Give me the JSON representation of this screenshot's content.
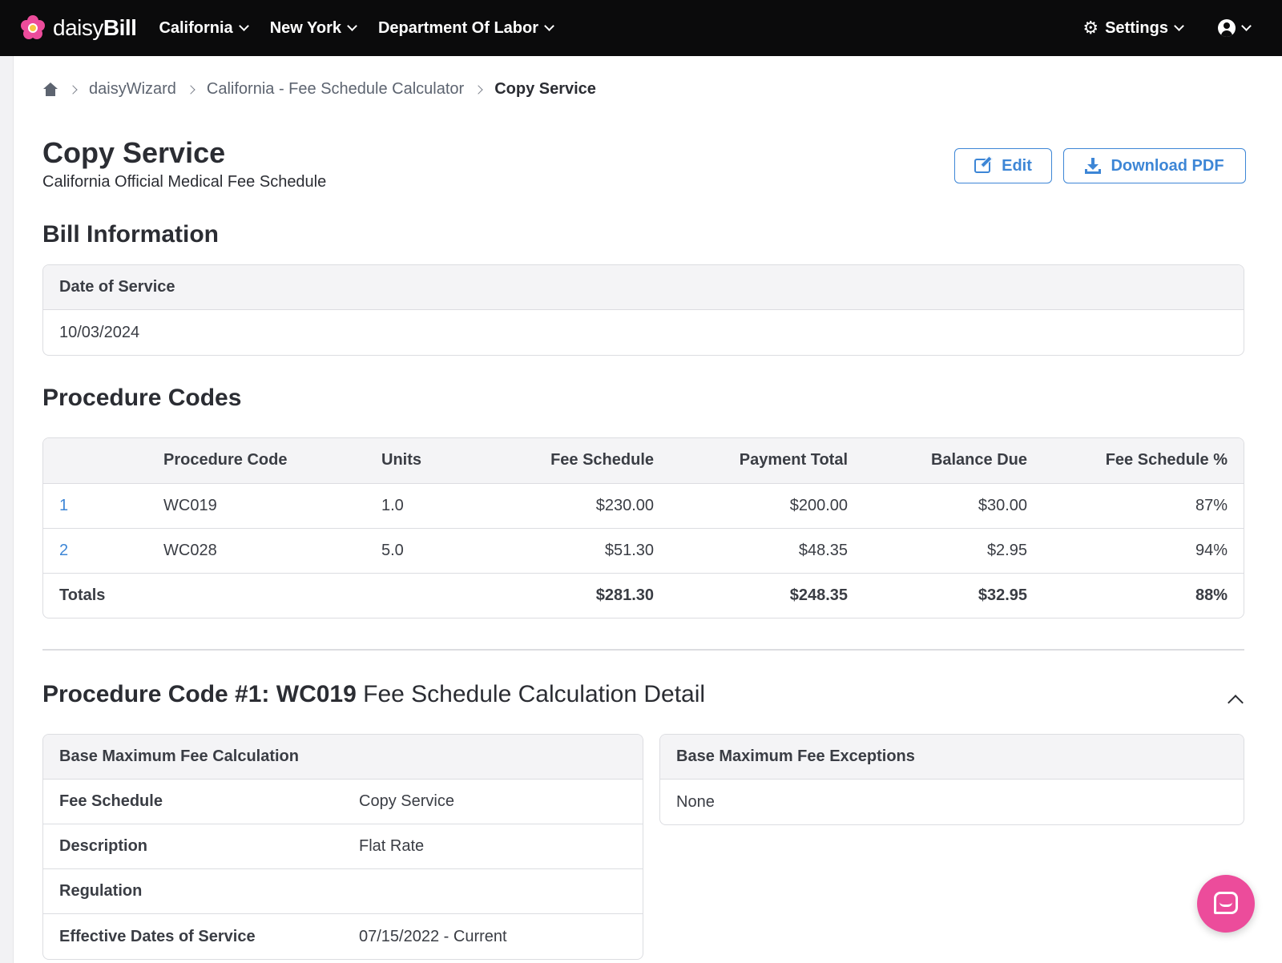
{
  "nav": {
    "logo_light": "daisy",
    "logo_bold": "Bill",
    "items": [
      {
        "label": "California"
      },
      {
        "label": "New York"
      },
      {
        "label": "Department Of Labor"
      }
    ],
    "settings_label": "Settings"
  },
  "breadcrumb": {
    "items": [
      "daisyWizard",
      "California - Fee Schedule Calculator"
    ],
    "current": "Copy Service"
  },
  "page": {
    "title": "Copy Service",
    "subtitle": "California Official Medical Fee Schedule",
    "edit_label": "Edit",
    "download_label": "Download PDF"
  },
  "bill_info": {
    "title": "Bill Information",
    "date_label": "Date of Service",
    "date_value": "10/03/2024"
  },
  "procedures": {
    "title": "Procedure Codes",
    "headers": [
      "",
      "Procedure Code",
      "Units",
      "Fee Schedule",
      "Payment Total",
      "Balance Due",
      "Fee Schedule %"
    ],
    "rows": [
      {
        "num": "1",
        "code": "WC019",
        "units": "1.0",
        "fee": "$230.00",
        "payment": "$200.00",
        "balance": "$30.00",
        "pct": "87%"
      },
      {
        "num": "2",
        "code": "WC028",
        "units": "5.0",
        "fee": "$51.30",
        "payment": "$48.35",
        "balance": "$2.95",
        "pct": "94%"
      }
    ],
    "totals": {
      "label": "Totals",
      "fee": "$281.30",
      "payment": "$248.35",
      "balance": "$32.95",
      "pct": "88%"
    }
  },
  "detail": {
    "title_bold": "Procedure Code #1: WC019",
    "title_rest": " Fee Schedule Calculation Detail",
    "base_calc": {
      "title": "Base Maximum Fee Calculation",
      "rows": [
        {
          "k": "Fee Schedule",
          "v": "Copy Service"
        },
        {
          "k": "Description",
          "v": "Flat Rate"
        },
        {
          "k": "Regulation",
          "v": ""
        },
        {
          "k": "Effective Dates of Service",
          "v": "07/15/2022 - Current"
        }
      ]
    },
    "exceptions": {
      "title": "Base Maximum Fee Exceptions",
      "value": "None"
    }
  },
  "colors": {
    "accent": "#3d86d6",
    "brand": "#ec4c9b",
    "nav_bg": "#0b0b0c"
  }
}
